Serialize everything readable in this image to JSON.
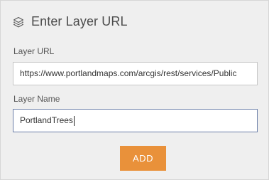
{
  "header": {
    "icon": "layers-icon",
    "title": "Enter Layer URL"
  },
  "layer_url": {
    "label": "Layer URL",
    "value": "https://www.portlandmaps.com/arcgis/rest/services/Public"
  },
  "layer_name": {
    "label": "Layer Name",
    "value": "PortlandTrees"
  },
  "add_button": {
    "label": "ADD",
    "color": "#e9913a"
  }
}
